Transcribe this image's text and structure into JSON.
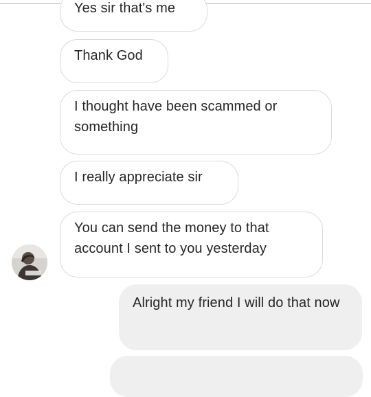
{
  "conversation": {
    "messages": [
      {
        "direction": "received",
        "text": "Yes sir that's me"
      },
      {
        "direction": "received",
        "text": "Thank God"
      },
      {
        "direction": "received",
        "text": "I thought have been scammed or something"
      },
      {
        "direction": "received",
        "text": "I really appreciate sir"
      },
      {
        "direction": "received",
        "text": "You can send the money to that account I sent to you yesterday"
      },
      {
        "direction": "sent",
        "text": "Alright my friend I will do that now"
      },
      {
        "direction": "sent",
        "text": ""
      }
    ]
  },
  "colors": {
    "received_bubble_border": "#dbdbdb",
    "sent_bubble_fill": "#efefef",
    "text": "#262626"
  },
  "icons": {
    "avatar": "avatar-photo-icon"
  }
}
